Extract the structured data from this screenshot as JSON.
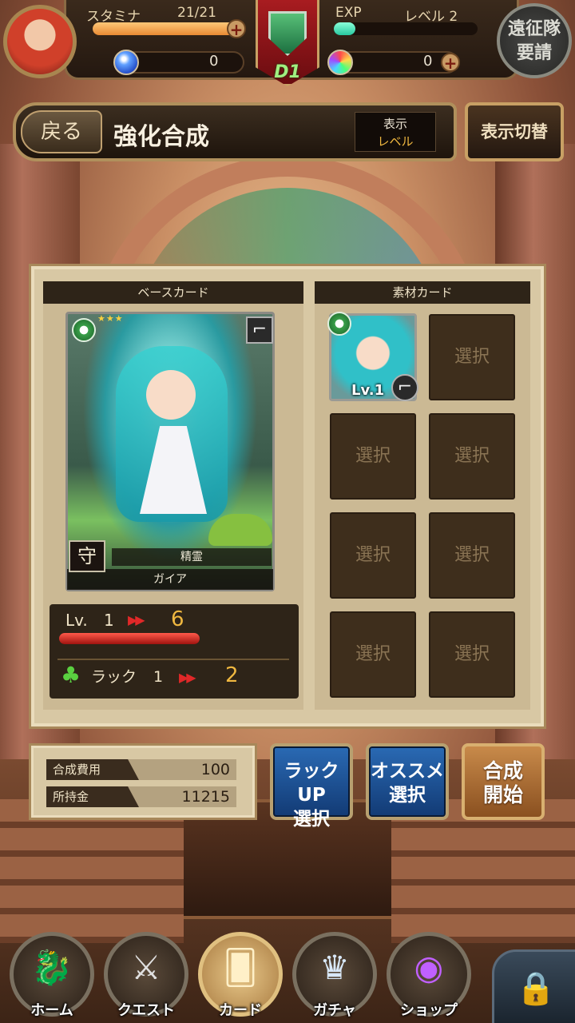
{
  "hud": {
    "stamina_label": "スタミナ",
    "stamina_value": "21/21",
    "stamina_fraction": 1.0,
    "exp_label": "EXP",
    "level_label": "レベル 2",
    "exp_fraction": 0.15,
    "blue_gem_count": "0",
    "rainbow_gem_count": "0",
    "rank": "D1",
    "expedition_label_1": "遠征隊",
    "expedition_label_2": "要請",
    "plus_symbol": "+"
  },
  "title_bar": {
    "back_label": "戻る",
    "title": "強化合成",
    "display_mode_line1": "表示",
    "display_mode_line2": "レベル",
    "toggle_label": "表示切替"
  },
  "base_card": {
    "header": "ベースカード",
    "rarity_stars": "★★★",
    "type_label": "守",
    "race_label": "精霊",
    "name": "ガイア",
    "weapon_glyph": "⌐",
    "attribute_icon": "wind-icon"
  },
  "stats": {
    "lv_label": "Lv.",
    "lv_from": "1",
    "lv_to": "6",
    "lv_fraction": 1.0,
    "luck_label": "ラック",
    "luck_from": "1",
    "luck_to": "2",
    "arrows": "▶▶",
    "clover_glyph": "♣"
  },
  "materials": {
    "header": "素材カード",
    "first_card_level": "Lv.1",
    "slot_label": "選択",
    "slots": [
      "選択",
      "選択",
      "選択",
      "選択",
      "選択",
      "選択",
      "選択"
    ]
  },
  "cost": {
    "fusion_cost_label": "合成費用",
    "fusion_cost_value": "100",
    "money_label": "所持金",
    "money_value": "11215"
  },
  "actions": {
    "luck_up_line1": "ラックUP",
    "luck_up_line2": "選択",
    "recommend_line1": "オススメ",
    "recommend_line2": "選択",
    "fuse_line1": "合成",
    "fuse_line2": "開始"
  },
  "nav": {
    "items": [
      {
        "label": "ホーム",
        "icon": "dragon-icon",
        "glyph": "🐉"
      },
      {
        "label": "クエスト",
        "icon": "crossed-swords-icon",
        "glyph": "⚔"
      },
      {
        "label": "カード",
        "icon": "cards-icon",
        "glyph": "🂠"
      },
      {
        "label": "ガチャ",
        "icon": "goddess-icon",
        "glyph": "♛"
      },
      {
        "label": "ショップ",
        "icon": "rainbow-gem-icon",
        "glyph": "◉"
      }
    ],
    "lock_glyph": "🔒"
  },
  "colors": {
    "accent_gold": "#f0b840",
    "stamina_orange": "#e88a34",
    "exp_teal": "#28c8a0",
    "button_blue": "#2a6ab4"
  }
}
